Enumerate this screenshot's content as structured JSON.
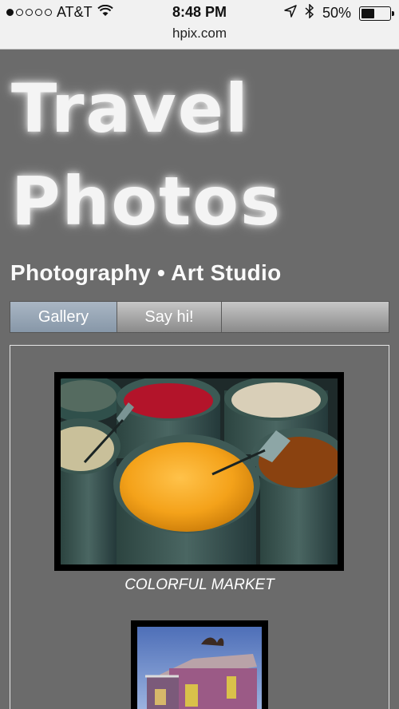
{
  "status_bar": {
    "carrier": "AT&T",
    "time": "8:48 PM",
    "battery": "50%",
    "battery_level": 0.5
  },
  "url_bar": {
    "url": "hpix.com"
  },
  "site": {
    "title_line1": "Travel",
    "title_line2": "Photos",
    "subtitle": "Photography • Art Studio"
  },
  "nav": {
    "tabs": [
      {
        "label": "Gallery",
        "active": true
      },
      {
        "label": "Say hi!",
        "active": false
      },
      {
        "label": "",
        "active": false
      }
    ]
  },
  "gallery": {
    "items": [
      {
        "caption": "COLORFUL MARKET"
      },
      {
        "caption": ""
      }
    ]
  },
  "colors": {
    "page_background": "#6b6b6b",
    "tab_active": "#97a6b6",
    "tab_inactive": "#a9a9a9"
  }
}
